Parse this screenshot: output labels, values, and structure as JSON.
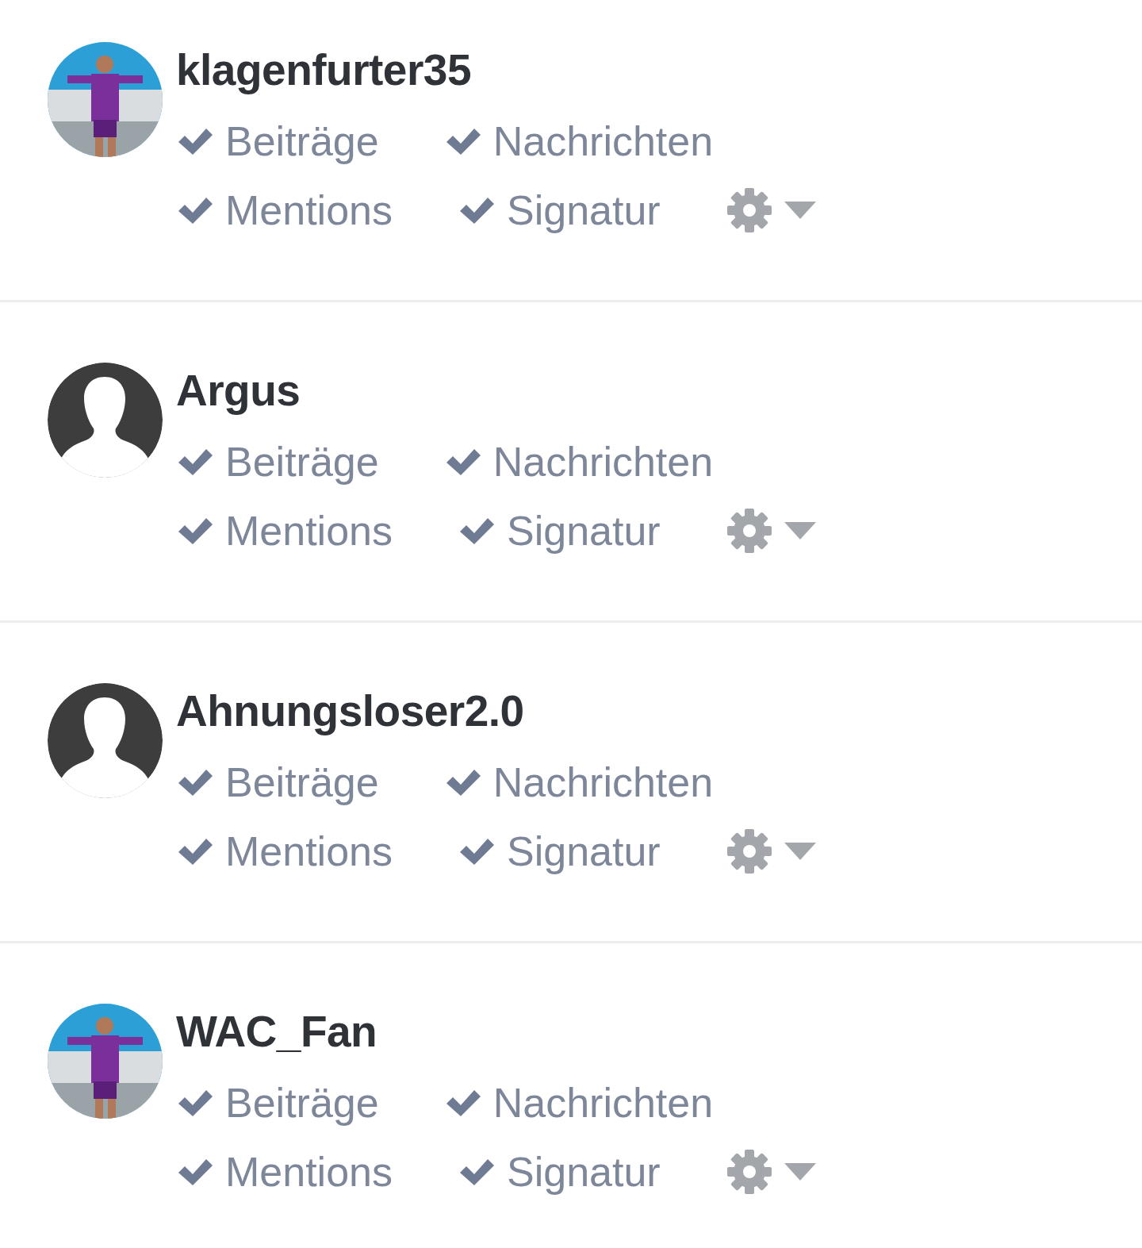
{
  "users": [
    {
      "name": "klagenfurter35",
      "settings": [
        {
          "label": "Beiträge",
          "checked": true
        },
        {
          "label": "Nachrichten",
          "checked": true
        },
        {
          "label": "Mentions",
          "checked": true
        },
        {
          "label": "Signatur",
          "checked": true
        }
      ]
    },
    {
      "name": "Argus",
      "avatar": {
        "kind": "silhouette"
      },
      "settings": [
        {
          "label": "Beiträge",
          "checked": true
        },
        {
          "label": "Nachrichten",
          "checked": true
        },
        {
          "label": "Mentions",
          "checked": true
        },
        {
          "label": "Signatur",
          "checked": true
        }
      ]
    },
    {
      "name": "Ahnungsloser2.0",
      "avatar": {
        "kind": "silhouette"
      },
      "settings": [
        {
          "label": "Beiträge",
          "checked": true
        },
        {
          "label": "Nachrichten",
          "checked": true
        },
        {
          "label": "Mentions",
          "checked": true
        },
        {
          "label": "Signatur",
          "checked": true
        }
      ]
    },
    {
      "name": "WAC_Fan",
      "settings": [
        {
          "label": "Beiträge",
          "checked": true
        },
        {
          "label": "Nachrichten",
          "checked": true
        },
        {
          "label": "Mentions",
          "checked": true
        },
        {
          "label": "Signatur",
          "checked": true
        }
      ]
    }
  ]
}
